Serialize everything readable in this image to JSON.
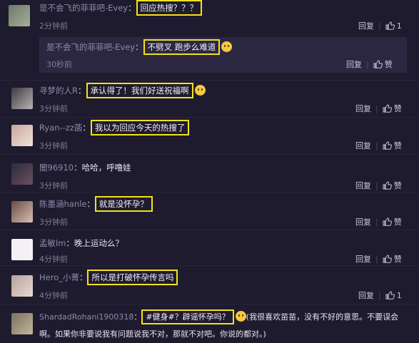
{
  "ui": {
    "reply_label": "回复",
    "like_label": "赞"
  },
  "comments": [
    {
      "user": "是不会飞的菲菲吧-Evey",
      "sep": "：",
      "text": "回应热搜？？？",
      "time": "2分钟前",
      "likes": "1"
    },
    {
      "user": "是不会飞的菲菲吧-Evey",
      "sep": "：",
      "text": "不劈叉  跑步么难道",
      "time": "30秒前",
      "likes": "赞"
    },
    {
      "user": "寻梦的人R",
      "sep": "：",
      "text": "承认得了！我们好送祝福啊",
      "time": "3分钟前",
      "likes": "赞"
    },
    {
      "user": "Ryan--zz菡",
      "sep": "：",
      "text": "我以为回应今天的热搜了",
      "time": "3分钟前",
      "likes": "赞"
    },
    {
      "user": "闇96910",
      "sep": "：",
      "text": "哈哈，呼噜娃",
      "time": "3分钟前",
      "likes": "赞"
    },
    {
      "user": "陈墨涵hanle",
      "sep": "：",
      "text": "就是没怀孕？",
      "time": "3分钟前",
      "likes": "赞"
    },
    {
      "user": "孟敏lm",
      "sep": "：",
      "text": "晚上运动么？",
      "time": "4分钟前",
      "likes": "赞"
    },
    {
      "user": "Hero_小菁",
      "sep": "：",
      "text": "所以是打破怀孕传言吗",
      "time": "4分钟前",
      "likes": "1"
    },
    {
      "user": "ShardadRohani1900318",
      "sep": "：",
      "text": "#健身#？辟谣怀孕吗？",
      "text_tail": "(我很喜欢苗苗，没有不好的意思。不要误会",
      "text_line2": "啊。如果你非要说我有问题说我不对，那就不对吧。你说的都对。)"
    }
  ],
  "colors": {
    "background": "#1f1b2e",
    "highlight_box": "#f2e11c",
    "username": "#8e89a8"
  }
}
